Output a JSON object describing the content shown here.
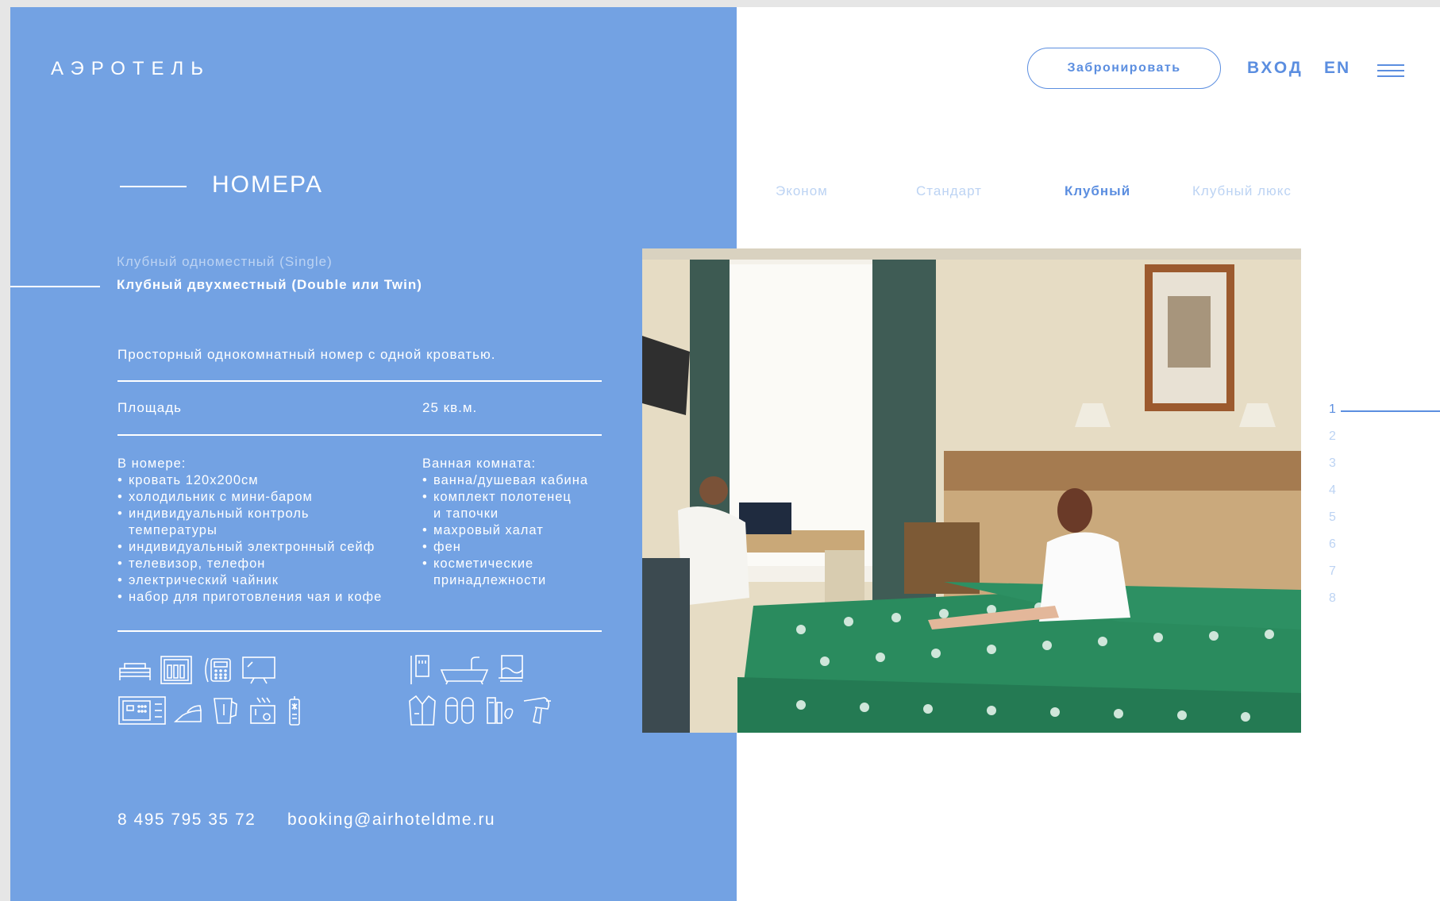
{
  "header": {
    "logo": "АЭРОТЕЛЬ",
    "book_button": "Забронировать",
    "login": "ВХОД",
    "language": "EN",
    "menu_icon": "hamburger-menu-icon"
  },
  "section": {
    "title": "НОМЕРА"
  },
  "categories": [
    {
      "label": "Эконом",
      "active": false
    },
    {
      "label": "Стандарт",
      "active": false
    },
    {
      "label": "Клубный",
      "active": true
    },
    {
      "label": "Клубный люкс",
      "active": false
    }
  ],
  "room_types": [
    {
      "label": "Клубный одноместный (Single)",
      "active": false
    },
    {
      "label": "Клубный двухместный (Double или Twin)",
      "active": true
    }
  ],
  "room": {
    "description": "Просторный однокомнатный номер с одной кроватью.",
    "area_label": "Площадь",
    "area_value": "25 кв.м.",
    "in_room_title": "В номере:",
    "in_room": [
      "кровать 120x200см",
      "холодильник с мини-баром",
      "индивидуальный контроль",
      "температуры",
      "индивидуальный электронный сейф",
      "телевизор, телефон",
      "электрический чайник",
      "набор для приготовления чая и кофе"
    ],
    "bathroom_title": "Ванная комната:",
    "bathroom": [
      "ванна/душевая кабина",
      "комплект полотенец",
      "и тапочки",
      "махровый халат",
      "фен",
      "косметические",
      "принадлежности"
    ],
    "room_icons_row1": [
      "bed-icon",
      "minibar-icon",
      "phone-icon",
      "tv-icon"
    ],
    "room_icons_row2": [
      "safe-icon",
      "iron-icon",
      "kettle-icon",
      "tea-set-icon",
      "ac-remote-icon"
    ],
    "bath_icons_row1": [
      "shower-icon",
      "bathtub-icon",
      "towel-icon"
    ],
    "bath_icons_row2": [
      "bathrobe-icon",
      "slippers-icon",
      "toiletries-icon",
      "hairdryer-icon"
    ]
  },
  "contacts": {
    "phone": "8 495 795 35 72",
    "email": "booking@airhoteldme.ru"
  },
  "gallery": {
    "pages": [
      "1",
      "2",
      "3",
      "4",
      "5",
      "6",
      "7",
      "8"
    ],
    "active_page": "1"
  },
  "colors": {
    "panel": "#73a2e3",
    "accent": "#5b8ee0",
    "inactive": "#bcd3f3"
  }
}
